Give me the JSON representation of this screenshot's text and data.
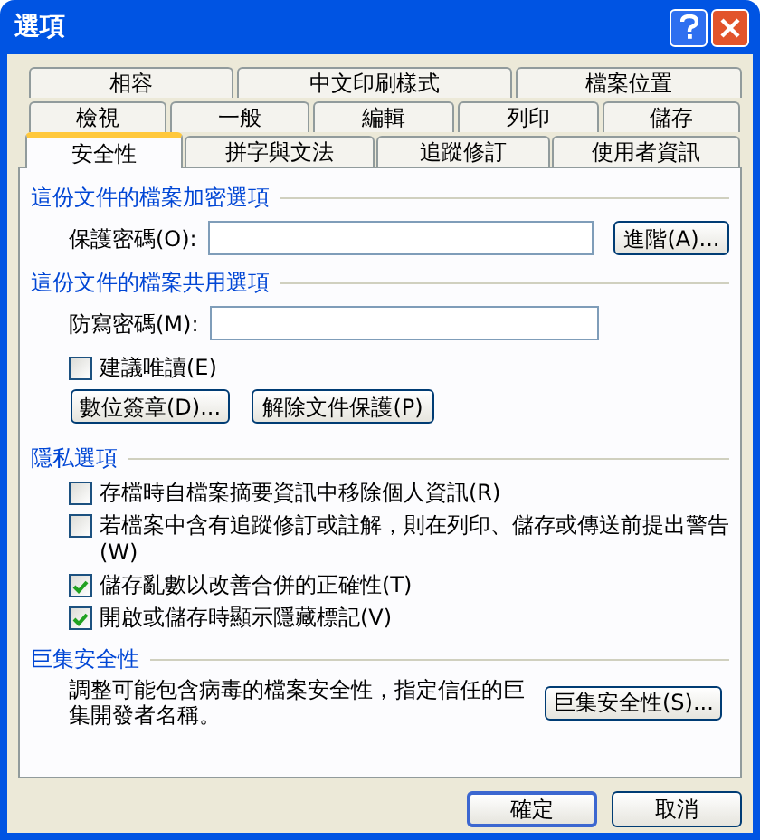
{
  "window": {
    "title": "選項"
  },
  "tab_rows": [
    [
      {
        "label": "相容",
        "selected": false
      },
      {
        "label": "中文印刷樣式",
        "selected": false
      },
      {
        "label": "檔案位置",
        "selected": false
      }
    ],
    [
      {
        "label": "檢視",
        "selected": false
      },
      {
        "label": "一般",
        "selected": false
      },
      {
        "label": "編輯",
        "selected": false
      },
      {
        "label": "列印",
        "selected": false
      },
      {
        "label": "儲存",
        "selected": false
      }
    ],
    [
      {
        "label": "安全性",
        "selected": true
      },
      {
        "label": "拼字與文法",
        "selected": false
      },
      {
        "label": "追蹤修訂",
        "selected": false
      },
      {
        "label": "使用者資訊",
        "selected": false
      }
    ]
  ],
  "encryption": {
    "title": "這份文件的檔案加密選項",
    "password_label": "保護密碼(O):",
    "button": "進階(A)..."
  },
  "sharing": {
    "title": "這份文件的檔案共用選項",
    "password_label": "防寫密碼(M):",
    "read_only": {
      "label": "建議唯讀(E)",
      "checked": false
    },
    "buttons": [
      "數位簽章(D)...",
      "解除文件保護(P)"
    ]
  },
  "privacy": {
    "title": "隱私選項",
    "options": [
      {
        "label": "存檔時自檔案摘要資訊中移除個人資訊(R)",
        "checked": false
      },
      {
        "label": "若檔案中含有追蹤修訂或註解，則在列印、儲存或傳送前提出警告(W)",
        "checked": false
      },
      {
        "label": "儲存亂數以改善合併的正確性(T)",
        "checked": true
      },
      {
        "label": "開啟或儲存時顯示隱藏標記(V)",
        "checked": true
      }
    ]
  },
  "macro": {
    "title": "巨集安全性",
    "description": "調整可能包含病毒的檔案安全性，指定信任的巨集開發者名稱。",
    "button": "巨集安全性(S)..."
  },
  "buttons": [
    "確定",
    "取消"
  ]
}
